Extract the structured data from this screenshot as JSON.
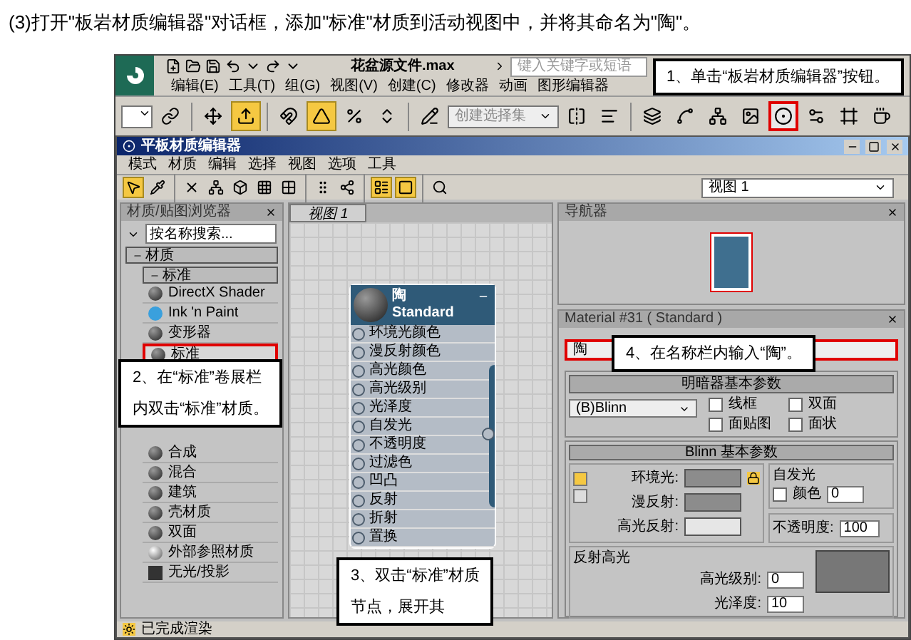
{
  "instruction": "(3)打开\"板岩材质编辑器\"对话框，添加\"标准\"材质到活动视图中，并将其命名为\"陶\"。",
  "app": {
    "title": "花盆源文件.max",
    "search": {
      "placeholder": "键入关键字或短语"
    },
    "menu": [
      "编辑(E)",
      "工具(T)",
      "组(G)",
      "视图(V)",
      "创建(C)",
      "修改器",
      "动画",
      "图形编辑器"
    ],
    "toolbar": [
      {
        "kind": "dropdown"
      },
      {
        "kind": "button",
        "active": false,
        "highlighted": false
      },
      {
        "kind": "separator"
      },
      {
        "kind": "button",
        "active": false,
        "highlighted": false
      },
      {
        "kind": "button",
        "active": true,
        "highlighted": false
      },
      {
        "kind": "separator"
      },
      {
        "kind": "button",
        "active": false,
        "highlighted": false
      },
      {
        "kind": "button",
        "active": true,
        "highlighted": false
      },
      {
        "kind": "button",
        "active": false,
        "highlighted": false
      },
      {
        "kind": "button",
        "active": false,
        "highlighted": false
      },
      {
        "kind": "separator"
      },
      {
        "kind": "button",
        "active": false,
        "highlighted": false
      },
      {
        "kind": "named",
        "placeholder": "创建选择集"
      },
      {
        "kind": "button",
        "active": false,
        "highlighted": false
      },
      {
        "kind": "button",
        "active": false,
        "highlighted": false
      },
      {
        "kind": "separator"
      },
      {
        "kind": "button",
        "active": false,
        "highlighted": false
      },
      {
        "kind": "button",
        "active": false,
        "highlighted": false
      },
      {
        "kind": "button",
        "active": false,
        "highlighted": false
      },
      {
        "kind": "button",
        "active": false,
        "highlighted": false
      },
      {
        "kind": "button",
        "active": false,
        "highlighted": true
      },
      {
        "kind": "button",
        "active": false,
        "highlighted": false
      },
      {
        "kind": "button",
        "active": false,
        "highlighted": false
      },
      {
        "kind": "button",
        "active": false,
        "highlighted": false
      }
    ]
  },
  "editor": {
    "title": "平板材质编辑器",
    "menu": [
      "模式",
      "材质",
      "编辑",
      "选择",
      "视图",
      "选项",
      "工具"
    ],
    "toolbar": [
      {
        "kind": "button",
        "active": true
      },
      {
        "kind": "button",
        "active": false
      },
      {
        "kind": "separator"
      },
      {
        "kind": "button",
        "active": false
      },
      {
        "kind": "button",
        "active": false
      },
      {
        "kind": "button",
        "active": false
      },
      {
        "kind": "button",
        "active": false
      },
      {
        "kind": "button",
        "active": false
      },
      {
        "kind": "separator"
      },
      {
        "kind": "button",
        "active": false
      },
      {
        "kind": "button",
        "active": false
      },
      {
        "kind": "separator"
      },
      {
        "kind": "button",
        "active": true
      },
      {
        "kind": "button",
        "active": true
      },
      {
        "kind": "separator"
      },
      {
        "kind": "button",
        "active": false
      }
    ],
    "view_select": "视图 1",
    "browser": {
      "title": "材质/贴图浏览器",
      "search": {
        "placeholder": "按名称搜索..."
      },
      "groups": [
        {
          "label": "材质",
          "expanded": true,
          "children": [
            {
              "label": "标准",
              "expanded": true,
              "children": [
                {
                  "label": "DirectX Shader",
                  "kind": "sphere",
                  "highlighted": false
                },
                {
                  "label": "Ink 'n Paint",
                  "kind": "toon",
                  "highlighted": false
                },
                {
                  "label": "变形器",
                  "kind": "sphere",
                  "highlighted": false
                },
                {
                  "label": "标准",
                  "kind": "sphere",
                  "highlighted": true
                },
                {
                  "label": "合成",
                  "kind": "sphere",
                  "highlighted": false
                },
                {
                  "label": "混合",
                  "kind": "sphere",
                  "highlighted": false
                },
                {
                  "label": "建筑",
                  "kind": "sphere",
                  "highlighted": false
                },
                {
                  "label": "壳材质",
                  "kind": "sphere",
                  "highlighted": false
                },
                {
                  "label": "双面",
                  "kind": "sphere",
                  "highlighted": false
                },
                {
                  "label": "外部参照材质",
                  "kind": "chrome",
                  "highlighted": false
                },
                {
                  "label": "无光/投影",
                  "kind": "matte",
                  "highlighted": false
                }
              ]
            }
          ]
        }
      ]
    },
    "view": {
      "tab": "视图 1",
      "node": {
        "name": "陶",
        "type": "Standard",
        "slots": [
          "环境光颜色",
          "漫反射颜色",
          "高光颜色",
          "高光级别",
          "光泽度",
          "自发光",
          "不透明度",
          "过滤色",
          "凹凸",
          "反射",
          "折射",
          "置换"
        ]
      }
    },
    "navigator": {
      "title": "导航器"
    },
    "material": {
      "title": "Material #31 ( Standard )",
      "name": "陶",
      "highlighted": true,
      "shader_rollout": {
        "title": "明暗器基本参数",
        "shader": "(B)Blinn",
        "options": [
          {
            "label": "线框",
            "checked": false
          },
          {
            "label": "双面",
            "checked": false
          },
          {
            "label": "面贴图",
            "checked": false
          },
          {
            "label": "面状",
            "checked": false
          }
        ]
      },
      "basic_rollout": {
        "title": "Blinn 基本参数",
        "colors": [
          {
            "label": "环境光:",
            "color": "#8c8c8c"
          },
          {
            "label": "漫反射:",
            "color": "#8c8c8c"
          },
          {
            "label": "高光反射:",
            "color": "#e6e6e6"
          }
        ],
        "self_illum": {
          "title": "自发光",
          "label": "颜色",
          "checked": false,
          "value": "0"
        },
        "opacity": {
          "label": "不透明度:",
          "value": "100"
        },
        "specular": {
          "title": "反射高光",
          "fields": [
            {
              "label": "高光级别:",
              "value": "0"
            },
            {
              "label": "光泽度:",
              "value": "10"
            }
          ]
        }
      }
    },
    "status": "已完成渲染"
  },
  "callouts": [
    {
      "lines": [
        "1、单击“板岩材质编辑器”按钮。"
      ]
    },
    {
      "lines": [
        "2、在“标准”卷展栏",
        "内双击“标准”材质。"
      ]
    },
    {
      "lines": [
        "3、双击“标准”材质",
        "节点，展开其"
      ]
    },
    {
      "lines": [
        "4、在名称栏内输入“陶”。"
      ]
    }
  ]
}
